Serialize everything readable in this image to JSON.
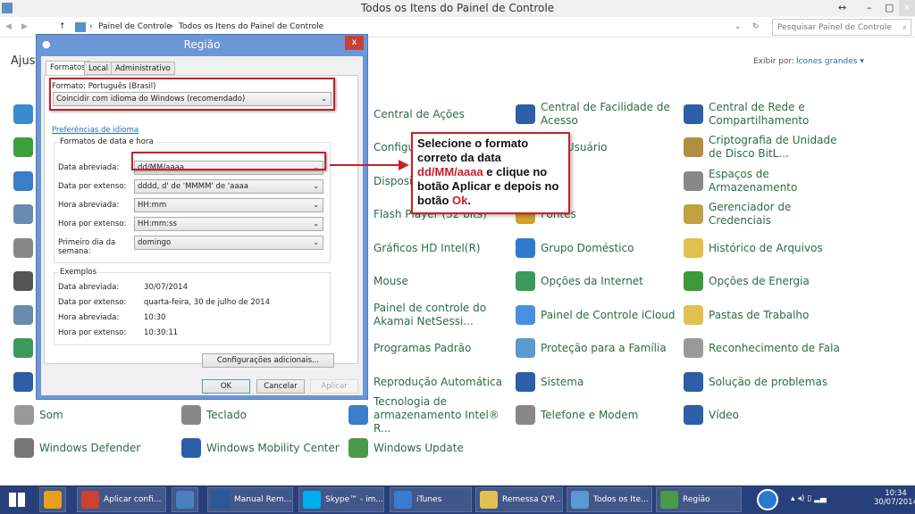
{
  "window": {
    "title": "Todos os Itens do Painel de Controle",
    "heading_partial": "Ajust"
  },
  "address": {
    "crumbs": [
      "Painel de Controle",
      "Todos os Itens do Painel de Controle"
    ],
    "search_placeholder": "Pesquisar Painel de Controle"
  },
  "view": {
    "label": "Exibir por:",
    "value": "Ícones grandes ▾"
  },
  "items": [
    {
      "label": "Central de Ações",
      "col": 2,
      "row": 0,
      "color": "#3a7dc9"
    },
    {
      "label": "Configu",
      "col": 2,
      "row": 1,
      "color": "#6a6a6a"
    },
    {
      "label": "Disposit",
      "col": 2,
      "row": 2,
      "color": "#6a6a6a"
    },
    {
      "label": "Flash Player (32 bits)",
      "col": 2,
      "row": 3,
      "color": "#b33"
    },
    {
      "label": "Gráficos HD Intel(R)",
      "col": 2,
      "row": 4,
      "color": "#3a7dc9"
    },
    {
      "label": "Mouse",
      "col": 2,
      "row": 5,
      "color": "#888"
    },
    {
      "label": "Painel de controle do Akamai NetSessi...",
      "col": 2,
      "row": 6,
      "color": "#e08030"
    },
    {
      "label": "Programas Padrão",
      "col": 2,
      "row": 7,
      "color": "#4a9a4a"
    },
    {
      "label": "Reprodução Automática",
      "col": 2,
      "row": 8,
      "color": "#3a7dc9"
    },
    {
      "label": "Tecnologia de armazenamento Intel® R...",
      "col": 2,
      "row": 9,
      "color": "#3a7dc9"
    },
    {
      "label": "Windows Update",
      "col": 2,
      "row": 10,
      "color": "#4a9a4a"
    },
    {
      "label": "Central de Facilidade de Acesso",
      "col": 3,
      "row": 0,
      "color": "#2c5fa8"
    },
    {
      "label": "s de Usuário",
      "col": 3,
      "row": 1,
      "color": "#5a8fc9"
    },
    {
      "label": "Fontes",
      "col": 3,
      "row": 3,
      "color": "#d0a030"
    },
    {
      "label": "Grupo Doméstico",
      "col": 3,
      "row": 4,
      "color": "#2f7ad0"
    },
    {
      "label": "Opções da Internet",
      "col": 3,
      "row": 5,
      "color": "#3a9a5a"
    },
    {
      "label": "Painel de Controle iCloud",
      "col": 3,
      "row": 6,
      "color": "#4a90e2"
    },
    {
      "label": "Proteção para a Família",
      "col": 3,
      "row": 7,
      "color": "#5a9ad0"
    },
    {
      "label": "Sistema",
      "col": 3,
      "row": 8,
      "color": "#2c5fa8"
    },
    {
      "label": "Telefone e Modem",
      "col": 3,
      "row": 9,
      "color": "#888"
    },
    {
      "label": "Central de Rede e Compartilhamento",
      "col": 4,
      "row": 0,
      "color": "#2c5fa8"
    },
    {
      "label": "Criptografia de Unidade de Disco BitL...",
      "col": 4,
      "row": 1,
      "color": "#b09040"
    },
    {
      "label": "Espaços de Armazenamento",
      "col": 4,
      "row": 2,
      "color": "#888"
    },
    {
      "label": "Gerenciador de Credenciais",
      "col": 4,
      "row": 3,
      "color": "#c0a040"
    },
    {
      "label": "Histórico de Arquivos",
      "col": 4,
      "row": 4,
      "color": "#e0c050"
    },
    {
      "label": "Opções de Energia",
      "col": 4,
      "row": 5,
      "color": "#3a9a3a"
    },
    {
      "label": "Pastas de Trabalho",
      "col": 4,
      "row": 6,
      "color": "#e0c050"
    },
    {
      "label": "Reconhecimento de Fala",
      "col": 4,
      "row": 7,
      "color": "#999"
    },
    {
      "label": "Solução de problemas",
      "col": 4,
      "row": 8,
      "color": "#2c5fa8"
    },
    {
      "label": "Vídeo",
      "col": 4,
      "row": 9,
      "color": "#2c5fa8"
    },
    {
      "label": "Som",
      "col": 0,
      "row": 9,
      "color": "#999"
    },
    {
      "label": "Windows Defender",
      "col": 0,
      "row": 10,
      "color": "#777"
    },
    {
      "label": "Teclado",
      "col": 1,
      "row": 9,
      "color": "#888"
    },
    {
      "label": "Windows Mobility Center",
      "col": 1,
      "row": 10,
      "color": "#2c5fa8"
    }
  ],
  "dialog": {
    "title": "Região",
    "close": "x",
    "tabs": [
      "Formatos",
      "Local",
      "Administrativo"
    ],
    "format_label": "Formato: Português (Brasil)",
    "format_value": "Coincidir com idioma do Windows (recomendado)",
    "lang_link": "Preferências de idioma",
    "group_title": "Formatos de data e hora",
    "fields": [
      {
        "label": "Data abreviada:",
        "value": "dd/MM/aaaa"
      },
      {
        "label": "Data por extenso:",
        "value": "dddd, d' de 'MMMM' de 'aaaa"
      },
      {
        "label": "Hora abreviada:",
        "value": "HH:mm"
      },
      {
        "label": "Hora por extenso:",
        "value": "HH:mm:ss"
      },
      {
        "label": "Primeiro dia da semana:",
        "value": "domingo"
      }
    ],
    "examples_title": "Exemplos",
    "examples": [
      {
        "label": "Data abreviada:",
        "value": "30/07/2014"
      },
      {
        "label": "Data por extenso:",
        "value": "quarta-feira, 30 de julho de 2014"
      },
      {
        "label": "Hora abreviada:",
        "value": "10:30"
      },
      {
        "label": "Hora por extenso:",
        "value": "10:30:11"
      }
    ],
    "additional": "Configurações adicionais...",
    "ok": "OK",
    "cancel": "Cancelar",
    "apply": "Aplicar"
  },
  "callout": {
    "line1": "Selecione o formato correto da data ",
    "highlight1": "dd/MM/aaaa",
    "line2": " e clique no botão Aplicar e depois no botão ",
    "highlight2": "Ok",
    "end": ".",
    "accent": "#c8202a"
  },
  "taskbar": {
    "buttons": [
      {
        "label": "",
        "color": "#e8a020"
      },
      {
        "label": "Aplicar confi...",
        "color": "#d04030"
      },
      {
        "label": "",
        "color": "#4a80c0"
      },
      {
        "label": "Manual Rem...",
        "color": "#2b5797"
      },
      {
        "label": "Skype™ - im...",
        "color": "#00aff0"
      },
      {
        "label": "iTunes",
        "color": "#3a7bd0"
      },
      {
        "label": "Remessa Q'P...",
        "color": "#e0c050"
      },
      {
        "label": "Todos os Ite...",
        "color": "#5a9ad0"
      },
      {
        "label": "Região",
        "color": "#4a9a4a"
      }
    ],
    "time": "10:34",
    "date": "30/07/2014"
  }
}
